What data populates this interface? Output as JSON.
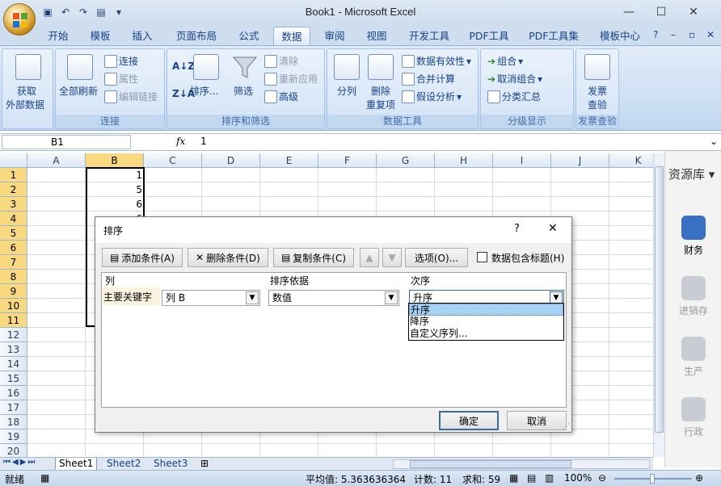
{
  "window": {
    "title": "Book1 - Microsoft Excel",
    "min": "—",
    "max": "☐",
    "close": "✕"
  },
  "tabs": [
    "开始",
    "模板",
    "插入",
    "页面布局",
    "公式",
    "数据",
    "审阅",
    "视图",
    "开发工具",
    "PDF工具",
    "PDF工具集",
    "模板中心"
  ],
  "active_tab": "数据",
  "ribbon": {
    "get_data": {
      "line1": "获取",
      "line2": "外部数据"
    },
    "connect": {
      "refresh_all": "全部刷新",
      "connections": "连接",
      "properties": "属性",
      "edit_links": "编辑链接",
      "title": "连接"
    },
    "sort_filter": {
      "sort": "排序...",
      "filter": "筛选",
      "clear": "清除",
      "reapply": "重新应用",
      "advanced": "高级",
      "title": "排序和筛选"
    },
    "data_tools": {
      "text_to_cols": "分列",
      "remove_dup_1": "删除",
      "remove_dup_2": "重复项",
      "validation": "数据有效性",
      "consolidate": "合并计算",
      "what_if": "假设分析",
      "title": "数据工具"
    },
    "outline": {
      "group": "组合",
      "ungroup": "取消组合",
      "subtotal": "分类汇总",
      "title": "分级显示"
    },
    "invoice": {
      "line1": "发票",
      "line2": "查验",
      "title": "发票查验"
    }
  },
  "formula_bar": {
    "name_box": "B1",
    "fx": "fx",
    "value": "1"
  },
  "columns": [
    "A",
    "B",
    "C",
    "D",
    "E",
    "F",
    "G",
    "H",
    "I",
    "J",
    "K"
  ],
  "rows": [
    "1",
    "2",
    "3",
    "4",
    "5",
    "6",
    "7",
    "8",
    "9",
    "10",
    "11",
    "12",
    "13",
    "14",
    "15",
    "16",
    "17",
    "18",
    "19",
    "20"
  ],
  "cells_b": [
    "1",
    "5",
    "6",
    "6"
  ],
  "side_panel": {
    "title": "资源库 ▾",
    "items": [
      "财务",
      "进销存",
      "生产",
      "行政"
    ]
  },
  "sheets": [
    "Sheet1",
    "Sheet2",
    "Sheet3"
  ],
  "status": {
    "ready": "就绪",
    "avg": "平均值: 5.363636364",
    "count": "计数: 11",
    "sum": "求和: 59",
    "zoom": "100%"
  },
  "dialog": {
    "title": "排序",
    "help": "?",
    "close": "✕",
    "add_level": "添加条件(A)",
    "delete_level": "删除条件(D)",
    "copy_level": "复制条件(C)",
    "options": "选项(O)...",
    "has_header": "数据包含标题(H)",
    "header_col": "列",
    "header_sort_on": "排序依据",
    "header_order": "次序",
    "row_label": "主要关键字",
    "col_value": "列 B",
    "sort_on_value": "数值",
    "order_value": "升序",
    "order_options": [
      "升序",
      "降序",
      "自定义序列..."
    ],
    "ok": "确定",
    "cancel": "取消"
  }
}
